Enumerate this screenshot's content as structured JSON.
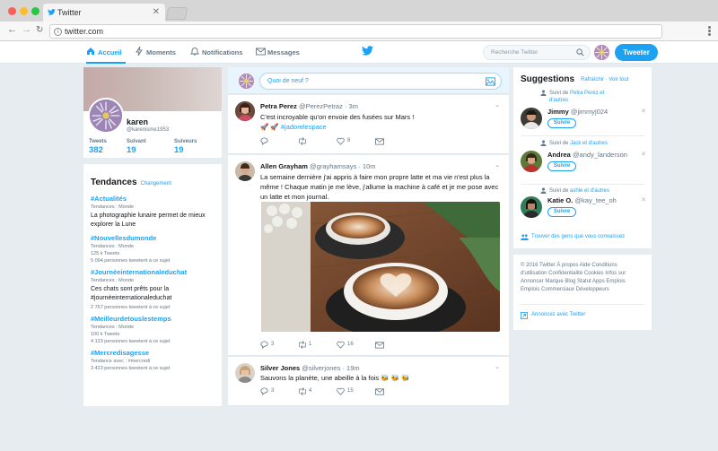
{
  "browser": {
    "tab_title": "Twitter",
    "url": "twitter.com"
  },
  "nav": {
    "home": "Accueil",
    "moments": "Moments",
    "notifications": "Notifications",
    "messages": "Messages",
    "search_placeholder": "Recherche Twitter",
    "tweet_button": "Tweeter"
  },
  "profile": {
    "name": "karen",
    "handle": "@karenisme1953",
    "stats": [
      {
        "label": "Tweets",
        "value": "382"
      },
      {
        "label": "Suivant",
        "value": "19"
      },
      {
        "label": "Suiveurs",
        "value": "19"
      }
    ]
  },
  "trends": {
    "title": "Tendances",
    "change": "Changement",
    "items": [
      {
        "tag": "#Actualités",
        "sub": "Tendances : Monde",
        "desc": "La photographie lunaire permet de mieux explorer la Lune",
        "count": ""
      },
      {
        "tag": "#Nouvellesdumonde",
        "sub": "Tendances : Monde",
        "desc": "",
        "count": "125 k Tweets",
        "count2": "5 094 personnes tweetent à ce sujet"
      },
      {
        "tag": "#Journéeinternationaleduchat",
        "sub": "Tendances : Monde",
        "desc": "Ces chats sont prêts pour la #journéeinternationaleduchat",
        "count": "2 757 personnes tweetent à ce sujet"
      },
      {
        "tag": "#Meilleurdetouslestemps",
        "sub": "Tendances : Monde",
        "desc": "",
        "count": "100 k Tweets",
        "count2": "4 123 personnes tweetent à ce sujet"
      },
      {
        "tag": "#Mercredisagesse",
        "sub": "Tendance avec : #mercredi",
        "desc": "",
        "count": "3 423 personnes tweetent à ce sujet"
      }
    ]
  },
  "compose": {
    "placeholder": "Quoi de neuf ?"
  },
  "tweets": [
    {
      "name": "Petra Perez",
      "handle": "@PerezPetraz",
      "time": "· 3m",
      "text": "C'est incroyable qu'on envoie des fusées sur Mars !",
      "hashtag": "#jadorelespace",
      "replies": "",
      "retweets": "",
      "likes": "8"
    },
    {
      "name": "Allen Grayham",
      "handle": "@grayhamsays",
      "time": "· 10m",
      "text": "La semaine dernière j'ai appris à faire mon propre latte et ma vie n'est plus la même ! Chaque matin je me lève, j'allume la machine à café et je me pose avec un latte et mon journal.",
      "replies": "3",
      "retweets": "1",
      "likes": "16"
    },
    {
      "name": "Silver Jones",
      "handle": "@silverjones",
      "time": "· 19m",
      "text": "Sauvons la planète, une abeille à la fois 🐝 🐝 🐝",
      "replies": "3",
      "retweets": "4",
      "likes": "15"
    }
  ],
  "suggestions": {
    "title": "Suggestions",
    "refresh": "Rafraîchir",
    "view_all": "Voir tout",
    "items": [
      {
        "via_prefix": "Suivi de",
        "via_names": "Petra Perez et d'autres",
        "name": "Jimmy",
        "handle": "@jimmyj024",
        "follow": "Suivre"
      },
      {
        "via_prefix": "Suivi de",
        "via_names": "Jack et d'autres",
        "name": "Andrea",
        "handle": "@andy_landerson",
        "follow": "Suivre"
      },
      {
        "via_prefix": "Suivi de",
        "via_names": "ashle et d'autres",
        "name": "Katie O.",
        "handle": "@kay_tee_oh",
        "follow": "Suivre"
      }
    ],
    "find_people": "Trouver des gens que vous connaissez"
  },
  "footer": {
    "text": "© 2016 Twitter À propos Aide Conditions d'utilisation Confidentialité Cookies Infos sur Annoncer Marque Blog Statut Apps Emplois Emplois Commerciaux Développeurs",
    "ads": "Annoncez avec Twitter"
  },
  "colors": {
    "accent": "#1da1f2",
    "background": "#e6ecf0"
  }
}
